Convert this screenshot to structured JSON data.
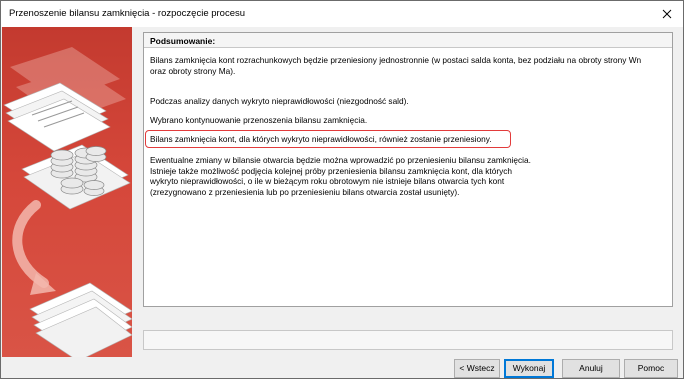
{
  "window": {
    "title": "Przenoszenie bilansu zamknięcia - rozpoczęcie procesu"
  },
  "summary": {
    "header": "Podsumowanie:",
    "lines": {
      "l1": "Bilans zamknięcia kont rozrachunkowych będzie przeniesiony jednostronnie  (w postaci salda konta, bez podziału na obroty strony Wn",
      "l1b": "oraz obroty strony Ma).",
      "l2": "Podczas analizy danych wykryto nieprawidłowości (niezgodność sald).",
      "l3": "Wybrano kontynuowanie przenoszenia bilansu zamknięcia.",
      "l4": "Bilans zamknięcia kont, dla których wykryto nieprawidłowości, również zostanie przeniesiony.",
      "l5": "Ewentualne zmiany w bilansie otwarcia będzie można wprowadzić po przeniesieniu bilansu zamknięcia.",
      "l6a": "Istnieje także możliwość podjęcia kolejnej próby przeniesienia bilansu zamknięcia kont, dla których",
      "l6b": "wykryto nieprawidłowości, o ile w bieżącym roku obrotowym nie istnieje bilans otwarcia tych kont",
      "l6c": "(zrezygnowano z przeniesienia lub po przeniesieniu bilans otwarcia został usunięty)."
    }
  },
  "buttons": {
    "back": "< Wstecz",
    "execute": "Wykonaj",
    "cancel": "Anuluj",
    "help": "Pomoc"
  },
  "colors": {
    "side_panel": "#d04536",
    "highlight_border": "#e23b3b",
    "default_button_border": "#0078d7"
  }
}
